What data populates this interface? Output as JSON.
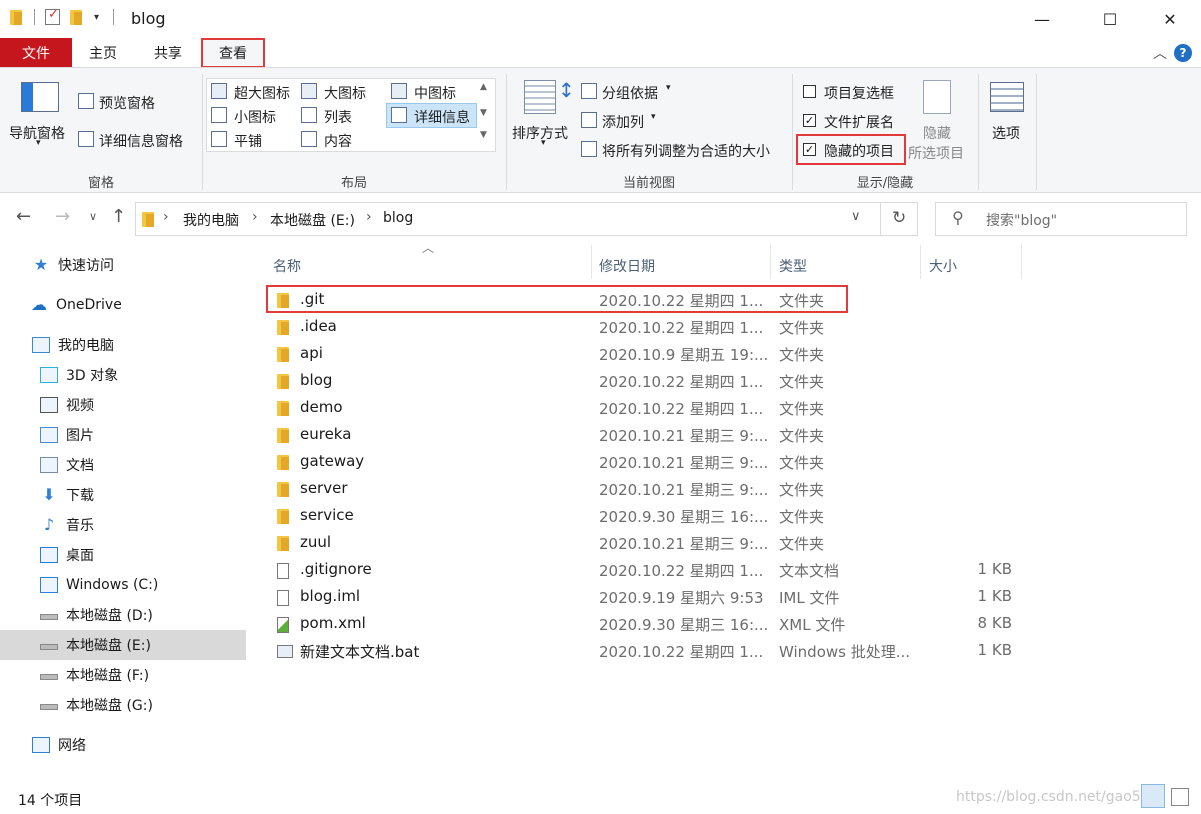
{
  "window": {
    "title": "blog",
    "minimize_glyph": "—",
    "maximize_glyph": "☐",
    "close_glyph": "✕"
  },
  "ribbon_tabs": {
    "file": "文件",
    "home": "主页",
    "share": "共享",
    "view": "查看",
    "collapse_glyph": "︿",
    "help_glyph": "?"
  },
  "ribbon": {
    "panes": {
      "label": "窗格",
      "nav_pane": "导航窗格",
      "preview_pane": "预览窗格",
      "details_pane": "详细信息窗格"
    },
    "layout": {
      "label": "布局",
      "extra_large_icons": "超大图标",
      "large_icons": "大图标",
      "medium_icons": "中图标",
      "small_icons": "小图标",
      "list": "列表",
      "details": "详细信息",
      "tiles": "平铺",
      "content": "内容"
    },
    "current_view": {
      "label": "当前视图",
      "sort_by": "排序方式",
      "group_by": "分组依据",
      "add_columns": "添加列",
      "size_all_columns": "将所有列调整为合适的大小"
    },
    "show_hide": {
      "label": "显示/隐藏",
      "item_checkboxes": "项目复选框",
      "file_extensions": "文件扩展名",
      "hidden_items": "隐藏的项目",
      "hide_selected_1": "隐藏",
      "hide_selected_2": "所选项目",
      "item_checkboxes_checked": false,
      "file_extensions_checked": true,
      "hidden_items_checked": true
    },
    "options": "选项"
  },
  "address": {
    "path": [
      "我的电脑",
      "本地磁盘 (E:)",
      "blog"
    ],
    "separator": "›",
    "search_placeholder": "搜索\"blog\""
  },
  "nav_pane": {
    "items": [
      {
        "label": "快速访问",
        "icon": "star-icon"
      },
      {
        "label": "OneDrive",
        "icon": "cloud-icon"
      },
      {
        "label": "我的电脑",
        "icon": "computer-icon"
      },
      {
        "label": "3D 对象",
        "icon": "cube-icon"
      },
      {
        "label": "视频",
        "icon": "video-icon"
      },
      {
        "label": "图片",
        "icon": "picture-icon"
      },
      {
        "label": "文档",
        "icon": "document-icon"
      },
      {
        "label": "下载",
        "icon": "download-arrow-icon"
      },
      {
        "label": "音乐",
        "icon": "music-note-icon"
      },
      {
        "label": "桌面",
        "icon": "desktop-icon"
      },
      {
        "label": "Windows (C:)",
        "icon": "windows-drive-icon"
      },
      {
        "label": "本地磁盘 (D:)",
        "icon": "drive-icon"
      },
      {
        "label": "本地磁盘 (E:)",
        "icon": "drive-icon"
      },
      {
        "label": "本地磁盘 (F:)",
        "icon": "drive-icon"
      },
      {
        "label": "本地磁盘 (G:)",
        "icon": "drive-icon"
      },
      {
        "label": "网络",
        "icon": "network-icon"
      }
    ],
    "selected_index": 12
  },
  "file_list": {
    "columns": {
      "name": "名称",
      "date": "修改日期",
      "type": "类型",
      "size": "大小"
    },
    "rows": [
      {
        "name": ".git",
        "date": "2020.10.22 星期四 1...",
        "type": "文件夹",
        "size": "",
        "icon": "folder-icon"
      },
      {
        "name": ".idea",
        "date": "2020.10.22 星期四 1...",
        "type": "文件夹",
        "size": "",
        "icon": "folder-icon"
      },
      {
        "name": "api",
        "date": "2020.10.9 星期五 19:...",
        "type": "文件夹",
        "size": "",
        "icon": "folder-icon"
      },
      {
        "name": "blog",
        "date": "2020.10.22 星期四 1...",
        "type": "文件夹",
        "size": "",
        "icon": "folder-icon"
      },
      {
        "name": "demo",
        "date": "2020.10.22 星期四 1...",
        "type": "文件夹",
        "size": "",
        "icon": "folder-icon"
      },
      {
        "name": "eureka",
        "date": "2020.10.21 星期三 9:...",
        "type": "文件夹",
        "size": "",
        "icon": "folder-icon"
      },
      {
        "name": "gateway",
        "date": "2020.10.21 星期三 9:...",
        "type": "文件夹",
        "size": "",
        "icon": "folder-icon"
      },
      {
        "name": "server",
        "date": "2020.10.21 星期三 9:...",
        "type": "文件夹",
        "size": "",
        "icon": "folder-icon"
      },
      {
        "name": "service",
        "date": "2020.9.30 星期三 16:...",
        "type": "文件夹",
        "size": "",
        "icon": "folder-icon"
      },
      {
        "name": "zuul",
        "date": "2020.10.21 星期三 9:...",
        "type": "文件夹",
        "size": "",
        "icon": "folder-icon"
      },
      {
        "name": ".gitignore",
        "date": "2020.10.22 星期四 1...",
        "type": "文本文档",
        "size": "1 KB",
        "icon": "text-file-icon"
      },
      {
        "name": "blog.iml",
        "date": "2020.9.19 星期六 9:53",
        "type": "IML 文件",
        "size": "1 KB",
        "icon": "file-icon"
      },
      {
        "name": "pom.xml",
        "date": "2020.9.30 星期三 16:...",
        "type": "XML 文件",
        "size": "8 KB",
        "icon": "xml-file-icon"
      },
      {
        "name": "新建文本文档.bat",
        "date": "2020.10.22 星期四 1...",
        "type": "Windows 批处理...",
        "size": "1 KB",
        "icon": "batch-file-icon"
      }
    ]
  },
  "status_bar": {
    "item_count": "14 个项目",
    "watermark": "https://blog.csdn.net/gao5"
  },
  "colors": {
    "file_tab": "#c4161c",
    "highlight_box": "#e23a3a",
    "selected_nav": "#d9d9d9",
    "folder": "#f4c542"
  }
}
